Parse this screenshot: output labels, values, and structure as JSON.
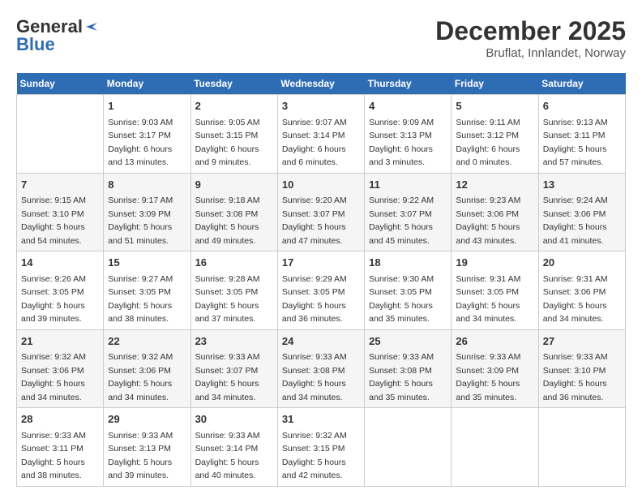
{
  "logo": {
    "line1": "General",
    "line2": "Blue"
  },
  "title": "December 2025",
  "subtitle": "Bruflat, Innlandet, Norway",
  "days_of_week": [
    "Sunday",
    "Monday",
    "Tuesday",
    "Wednesday",
    "Thursday",
    "Friday",
    "Saturday"
  ],
  "weeks": [
    [
      {
        "day": "",
        "info": ""
      },
      {
        "day": "1",
        "info": "Sunrise: 9:03 AM\nSunset: 3:17 PM\nDaylight: 6 hours\nand 13 minutes."
      },
      {
        "day": "2",
        "info": "Sunrise: 9:05 AM\nSunset: 3:15 PM\nDaylight: 6 hours\nand 9 minutes."
      },
      {
        "day": "3",
        "info": "Sunrise: 9:07 AM\nSunset: 3:14 PM\nDaylight: 6 hours\nand 6 minutes."
      },
      {
        "day": "4",
        "info": "Sunrise: 9:09 AM\nSunset: 3:13 PM\nDaylight: 6 hours\nand 3 minutes."
      },
      {
        "day": "5",
        "info": "Sunrise: 9:11 AM\nSunset: 3:12 PM\nDaylight: 6 hours\nand 0 minutes."
      },
      {
        "day": "6",
        "info": "Sunrise: 9:13 AM\nSunset: 3:11 PM\nDaylight: 5 hours\nand 57 minutes."
      }
    ],
    [
      {
        "day": "7",
        "info": "Sunrise: 9:15 AM\nSunset: 3:10 PM\nDaylight: 5 hours\nand 54 minutes."
      },
      {
        "day": "8",
        "info": "Sunrise: 9:17 AM\nSunset: 3:09 PM\nDaylight: 5 hours\nand 51 minutes."
      },
      {
        "day": "9",
        "info": "Sunrise: 9:18 AM\nSunset: 3:08 PM\nDaylight: 5 hours\nand 49 minutes."
      },
      {
        "day": "10",
        "info": "Sunrise: 9:20 AM\nSunset: 3:07 PM\nDaylight: 5 hours\nand 47 minutes."
      },
      {
        "day": "11",
        "info": "Sunrise: 9:22 AM\nSunset: 3:07 PM\nDaylight: 5 hours\nand 45 minutes."
      },
      {
        "day": "12",
        "info": "Sunrise: 9:23 AM\nSunset: 3:06 PM\nDaylight: 5 hours\nand 43 minutes."
      },
      {
        "day": "13",
        "info": "Sunrise: 9:24 AM\nSunset: 3:06 PM\nDaylight: 5 hours\nand 41 minutes."
      }
    ],
    [
      {
        "day": "14",
        "info": "Sunrise: 9:26 AM\nSunset: 3:05 PM\nDaylight: 5 hours\nand 39 minutes."
      },
      {
        "day": "15",
        "info": "Sunrise: 9:27 AM\nSunset: 3:05 PM\nDaylight: 5 hours\nand 38 minutes."
      },
      {
        "day": "16",
        "info": "Sunrise: 9:28 AM\nSunset: 3:05 PM\nDaylight: 5 hours\nand 37 minutes."
      },
      {
        "day": "17",
        "info": "Sunrise: 9:29 AM\nSunset: 3:05 PM\nDaylight: 5 hours\nand 36 minutes."
      },
      {
        "day": "18",
        "info": "Sunrise: 9:30 AM\nSunset: 3:05 PM\nDaylight: 5 hours\nand 35 minutes."
      },
      {
        "day": "19",
        "info": "Sunrise: 9:31 AM\nSunset: 3:05 PM\nDaylight: 5 hours\nand 34 minutes."
      },
      {
        "day": "20",
        "info": "Sunrise: 9:31 AM\nSunset: 3:06 PM\nDaylight: 5 hours\nand 34 minutes."
      }
    ],
    [
      {
        "day": "21",
        "info": "Sunrise: 9:32 AM\nSunset: 3:06 PM\nDaylight: 5 hours\nand 34 minutes."
      },
      {
        "day": "22",
        "info": "Sunrise: 9:32 AM\nSunset: 3:06 PM\nDaylight: 5 hours\nand 34 minutes."
      },
      {
        "day": "23",
        "info": "Sunrise: 9:33 AM\nSunset: 3:07 PM\nDaylight: 5 hours\nand 34 minutes."
      },
      {
        "day": "24",
        "info": "Sunrise: 9:33 AM\nSunset: 3:08 PM\nDaylight: 5 hours\nand 34 minutes."
      },
      {
        "day": "25",
        "info": "Sunrise: 9:33 AM\nSunset: 3:08 PM\nDaylight: 5 hours\nand 35 minutes."
      },
      {
        "day": "26",
        "info": "Sunrise: 9:33 AM\nSunset: 3:09 PM\nDaylight: 5 hours\nand 35 minutes."
      },
      {
        "day": "27",
        "info": "Sunrise: 9:33 AM\nSunset: 3:10 PM\nDaylight: 5 hours\nand 36 minutes."
      }
    ],
    [
      {
        "day": "28",
        "info": "Sunrise: 9:33 AM\nSunset: 3:11 PM\nDaylight: 5 hours\nand 38 minutes."
      },
      {
        "day": "29",
        "info": "Sunrise: 9:33 AM\nSunset: 3:13 PM\nDaylight: 5 hours\nand 39 minutes."
      },
      {
        "day": "30",
        "info": "Sunrise: 9:33 AM\nSunset: 3:14 PM\nDaylight: 5 hours\nand 40 minutes."
      },
      {
        "day": "31",
        "info": "Sunrise: 9:32 AM\nSunset: 3:15 PM\nDaylight: 5 hours\nand 42 minutes."
      },
      {
        "day": "",
        "info": ""
      },
      {
        "day": "",
        "info": ""
      },
      {
        "day": "",
        "info": ""
      }
    ]
  ]
}
